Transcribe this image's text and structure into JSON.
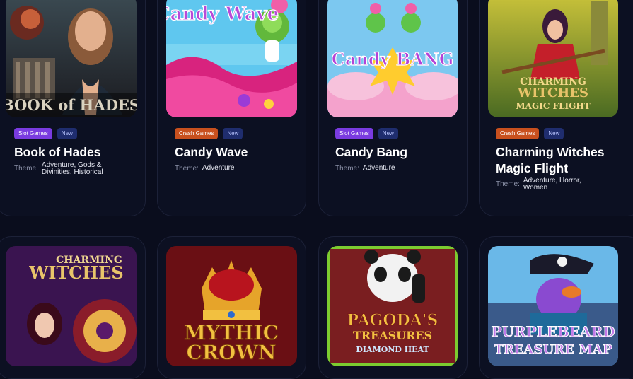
{
  "cards": [
    {
      "title": "Book of Hades",
      "category": "Slot Games",
      "badge": "New",
      "theme_label": "Theme:",
      "theme": "Adventure, Gods & Divinities, Historical",
      "art_text": "BOOK of HADES"
    },
    {
      "title": "Candy Wave",
      "category": "Crash Games",
      "badge": "New",
      "theme_label": "Theme:",
      "theme": "Adventure",
      "art_text": "Candy Wave"
    },
    {
      "title": "Candy Bang",
      "category": "Slot Games",
      "badge": "New",
      "theme_label": "Theme:",
      "theme": "Adventure",
      "art_text": "Candy BANG"
    },
    {
      "title": "Charming Witches Magic Flight",
      "category": "Crash Games",
      "badge": "New",
      "theme_label": "Theme:",
      "theme": "Adventure, Horror, Women",
      "art_text_1": "CHARMING",
      "art_text_2": "WITCHES",
      "art_text_3": "MAGIC FLIGHT"
    }
  ],
  "row2": [
    {
      "art_text_1": "CHARMING",
      "art_text_2": "WITCHES"
    },
    {
      "art_text_1": "MYTHIC",
      "art_text_2": "CROWN"
    },
    {
      "art_text_1": "PAGODA'S",
      "art_text_2": "TREASURES",
      "art_text_3": "DIAMOND HEAT"
    },
    {
      "art_text_1": "PURPLEBEARD",
      "art_text_2": "TREASURE MAP"
    }
  ],
  "colors": {
    "background": "#0a0d1d",
    "slot_tag": "#7a3be0",
    "crash_tag": "#c8501e",
    "new_tag": "#1f2d6e"
  }
}
